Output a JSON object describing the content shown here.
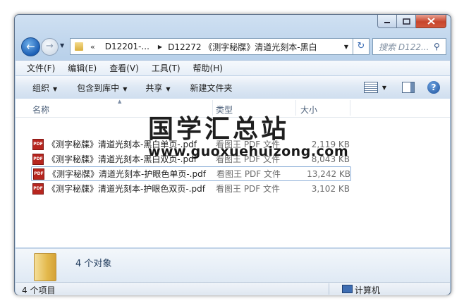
{
  "window": {
    "min_icon": "minimize-icon",
    "max_icon": "maximize-icon",
    "close_icon": "close-icon"
  },
  "nav": {
    "back_icon": "back-arrow-icon",
    "forward_icon": "forward-arrow-icon"
  },
  "address": {
    "overflow": "«",
    "crumb1": "D12201-...",
    "crumb2": "D12272 《测字秘牒》清道光刻本-黑白"
  },
  "search": {
    "placeholder": "搜索 D122..."
  },
  "menu": [
    "文件(F)",
    "编辑(E)",
    "查看(V)",
    "工具(T)",
    "帮助(H)"
  ],
  "toolbar": {
    "organize": "组织",
    "include_library": "包含到库中",
    "share": "共享",
    "new_folder": "新建文件夹"
  },
  "columns": {
    "name": "名称",
    "type": "类型",
    "size": "大小"
  },
  "files": [
    {
      "name": "《测字秘牒》清道光刻本-黑白单页-.pdf",
      "type": "看图王 PDF 文件",
      "size": "2,119 KB",
      "icon": "pdf-icon"
    },
    {
      "name": "《测字秘牒》清道光刻本-黑白双页-.pdf",
      "type": "看图王 PDF 文件",
      "size": "8,043 KB",
      "icon": "pdf-icon"
    },
    {
      "name": "《测字秘牒》清道光刻本-护眼色单页-.pdf",
      "type": "看图王 PDF 文件",
      "size": "13,242 KB",
      "icon": "pdf-icon"
    },
    {
      "name": "《测字秘牒》清道光刻本-护眼色双页-.pdf",
      "type": "看图王 PDF 文件",
      "size": "3,102 KB",
      "icon": "pdf-icon"
    }
  ],
  "details": {
    "count": "4 个对象"
  },
  "status": {
    "items": "4 个项目",
    "location": "计算机"
  },
  "watermark": {
    "title": "国学汇总站",
    "url": "www.guoxuehuizong.com"
  },
  "colors": {
    "pdf_red": "#b7261f",
    "selection_border": "#8fb1d9",
    "close_red": "#c7452c"
  }
}
